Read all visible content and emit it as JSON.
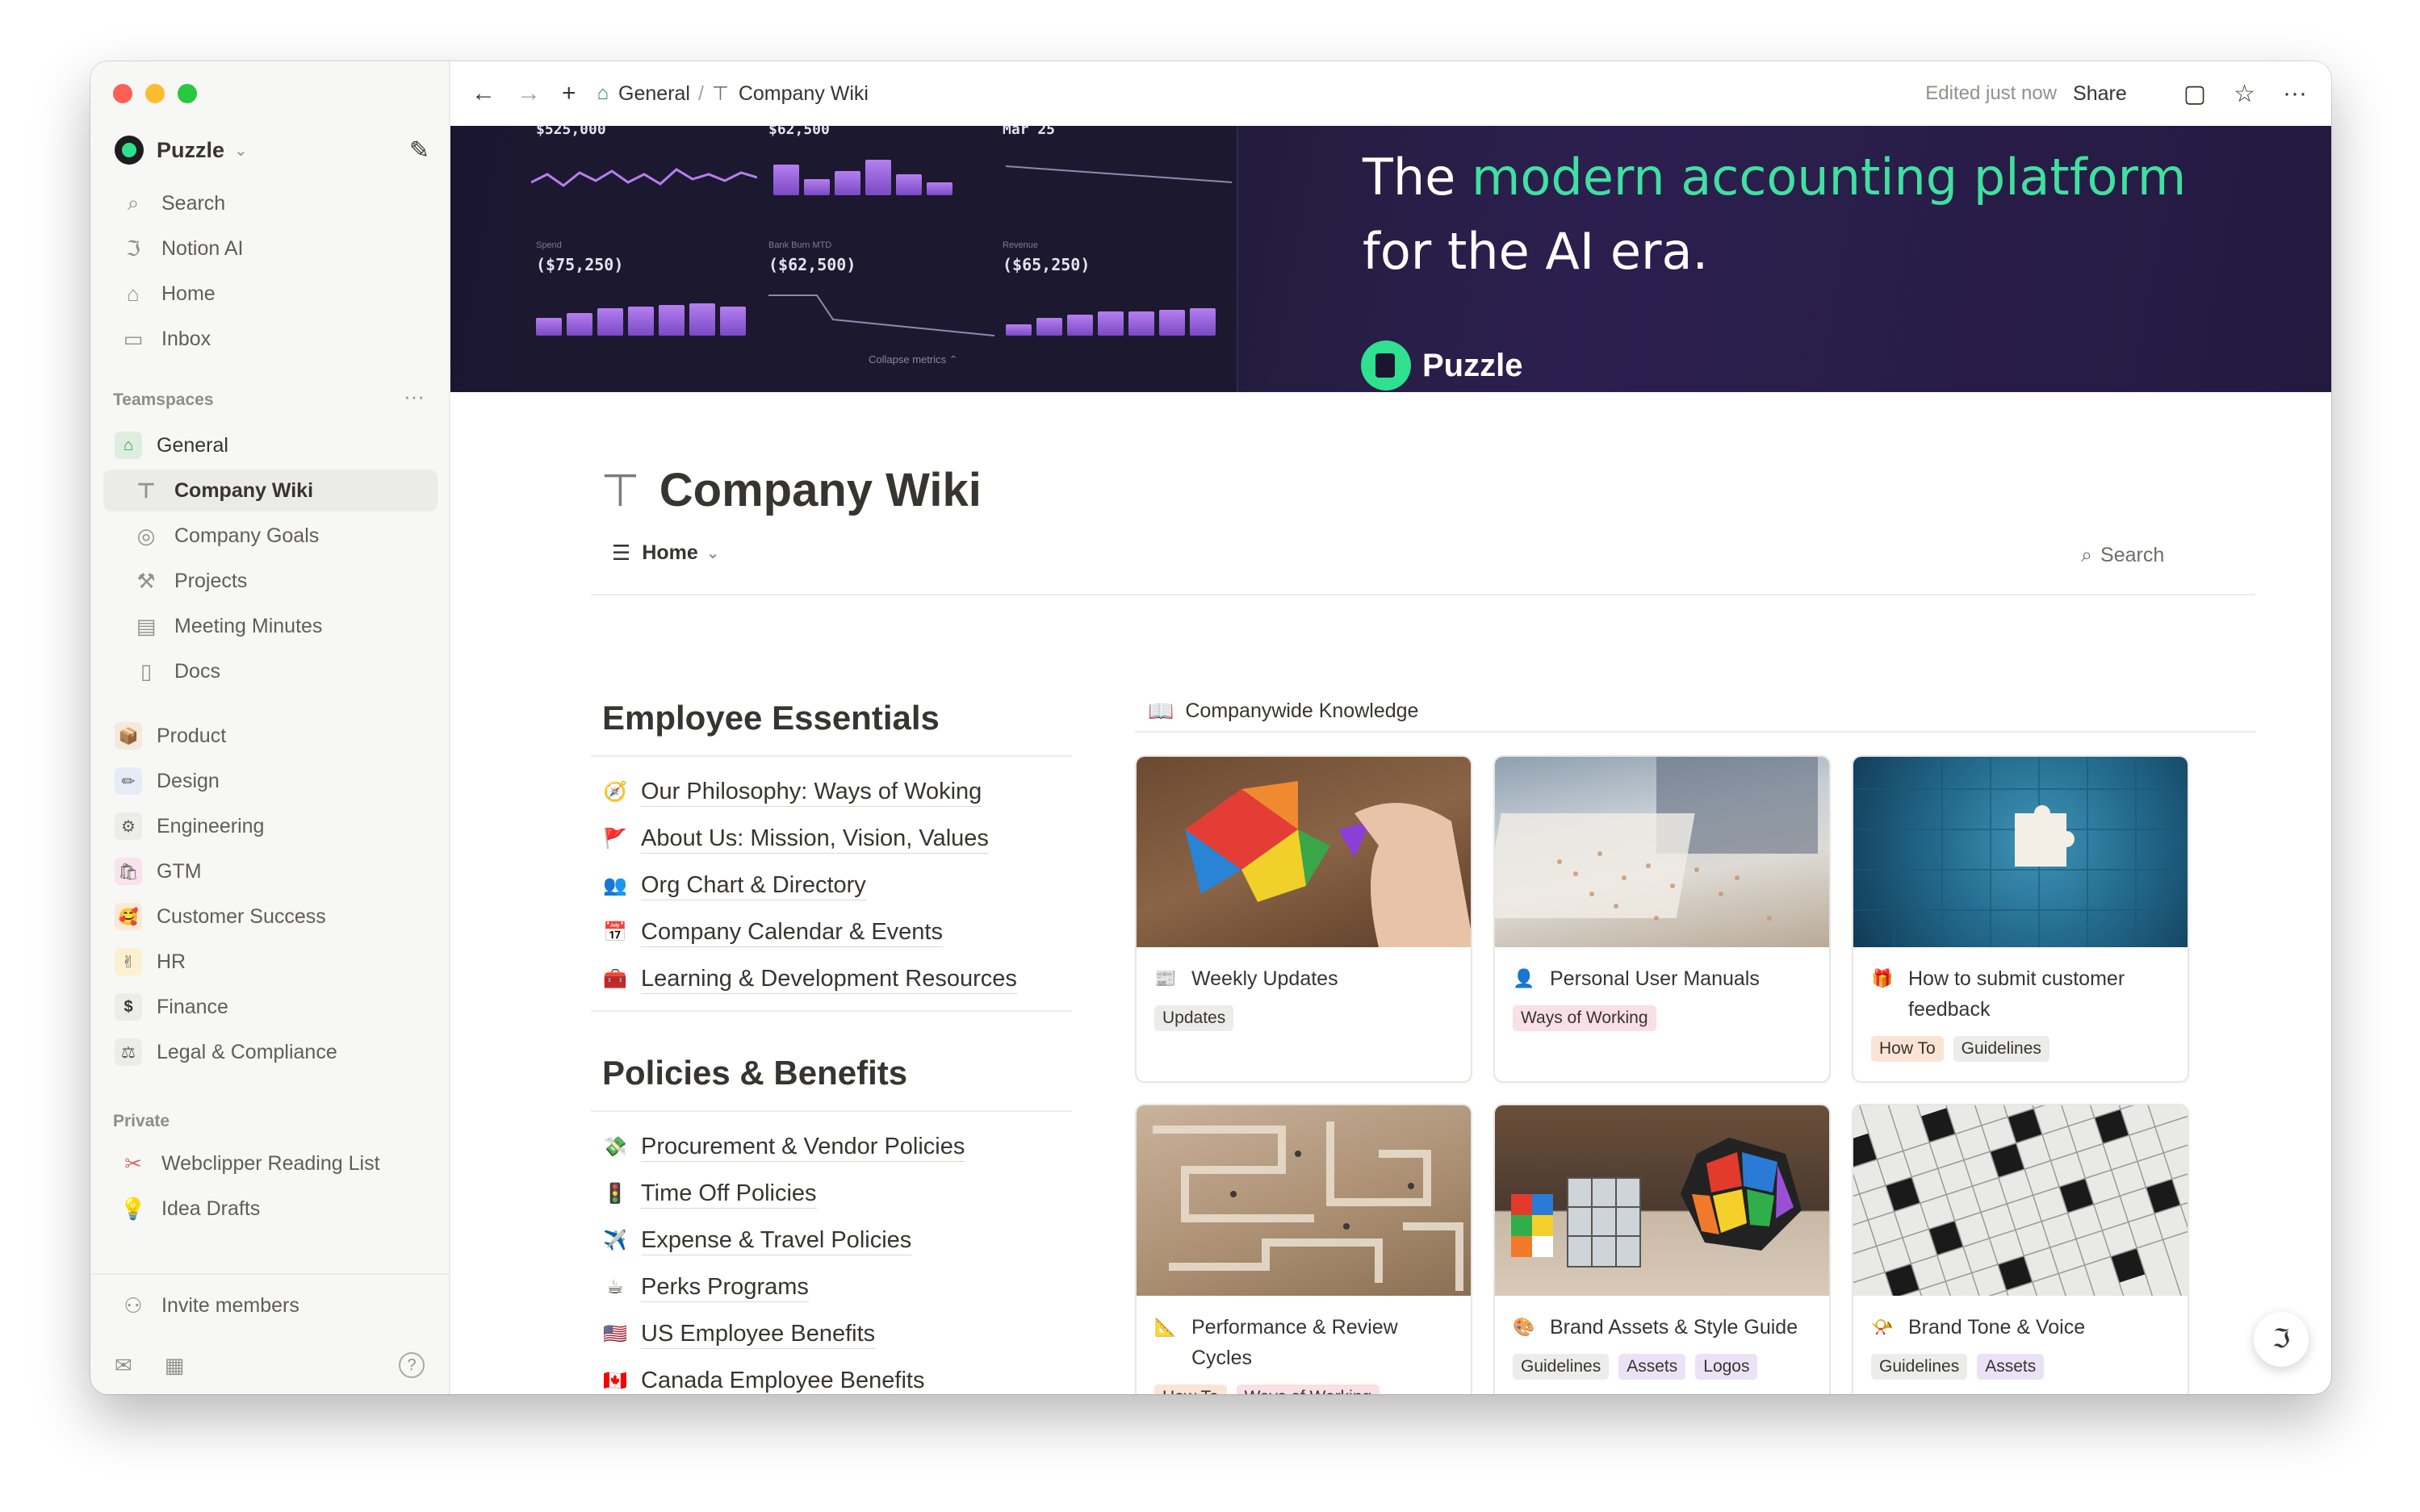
{
  "window": {
    "accent": "#2fe08e"
  },
  "sidebar": {
    "workspace": "Puzzle",
    "top_items": [
      {
        "label": "Search",
        "icon": "search-icon"
      },
      {
        "label": "Notion AI",
        "icon": "notion-ai-icon"
      },
      {
        "label": "Home",
        "icon": "home-icon"
      },
      {
        "label": "Inbox",
        "icon": "inbox-icon"
      }
    ],
    "teamspaces_label": "Teamspaces",
    "general": "General",
    "general_pages": [
      {
        "label": "Company Wiki",
        "icon": "org-chart-icon",
        "active": true
      },
      {
        "label": "Company Goals",
        "icon": "target-icon"
      },
      {
        "label": "Projects",
        "icon": "hammer-icon"
      },
      {
        "label": "Meeting Minutes",
        "icon": "calendar-icon"
      },
      {
        "label": "Docs",
        "icon": "document-icon"
      }
    ],
    "teams": [
      {
        "label": "Product",
        "icon": "package-icon",
        "color": "#f3e9dd"
      },
      {
        "label": "Design",
        "icon": "pencil-icon",
        "color": "#e4ecf7"
      },
      {
        "label": "Engineering",
        "icon": "gear-icon",
        "color": "#ececeb"
      },
      {
        "label": "GTM",
        "icon": "shopping-bags-icon",
        "color": "#f8e3ec"
      },
      {
        "label": "Customer Success",
        "icon": "smile-icon",
        "color": "#fbe9d4"
      },
      {
        "label": "HR",
        "icon": "hand-icon",
        "color": "#fbf0cf"
      },
      {
        "label": "Finance",
        "icon": "dollar-icon",
        "color": "#ececeb"
      },
      {
        "label": "Legal & Compliance",
        "icon": "scales-icon",
        "color": "#ececeb"
      }
    ],
    "private_label": "Private",
    "private_pages": [
      {
        "label": "Webclipper Reading List",
        "icon": "scissors-icon"
      },
      {
        "label": "Idea Drafts",
        "icon": "lightbulb-icon"
      }
    ],
    "invite": "Invite members"
  },
  "topbar": {
    "breadcrumb_parent": "General",
    "breadcrumb_sep": "/",
    "breadcrumb_current": "Company Wiki",
    "edited": "Edited just now",
    "share": "Share"
  },
  "banner": {
    "headline_pre": "The ",
    "headline_accent": "modern accounting platform",
    "headline_post": "for the AI era.",
    "brand": "Puzzle",
    "dashboard": {
      "top_vals": [
        "$525,000",
        "$62,500",
        "Mar 25"
      ],
      "panels": [
        {
          "label": "Spend",
          "value": "($75,250)"
        },
        {
          "label": "Bank Burn MTD",
          "value": "($62,500)"
        },
        {
          "label": "Revenue",
          "value": "($65,250)"
        }
      ],
      "collapse": "Collapse metrics ⌃"
    }
  },
  "page": {
    "title": "Company Wiki",
    "view_tab": "Home",
    "search": "Search"
  },
  "essentials": {
    "heading": "Employee Essentials",
    "links": [
      {
        "icon": "compass-icon",
        "emoji": "🧭",
        "label": "Our Philosophy: Ways of Woking"
      },
      {
        "icon": "flag-icon",
        "emoji": "🚩",
        "label": "About Us: Mission, Vision, Values"
      },
      {
        "icon": "people-icon",
        "emoji": "👥",
        "label": "Org Chart & Directory"
      },
      {
        "icon": "calendar-icon",
        "emoji": "📅",
        "label": "Company Calendar & Events"
      },
      {
        "icon": "toolbox-icon",
        "emoji": "🧰",
        "label": "Learning & Development Resources"
      }
    ]
  },
  "policies": {
    "heading": "Policies & Benefits",
    "links": [
      {
        "icon": "money-icon",
        "emoji": "💸",
        "label": "Procurement & Vendor Policies"
      },
      {
        "icon": "traffic-light-icon",
        "emoji": "🚦",
        "label": "Time Off Policies"
      },
      {
        "icon": "airplane-icon",
        "emoji": "✈️",
        "label": "Expense & Travel Policies"
      },
      {
        "icon": "coffee-icon",
        "emoji": "☕",
        "label": "Perks Programs"
      },
      {
        "icon": "us-flag-icon",
        "emoji": "🇺🇸",
        "label": "US Employee Benefits"
      },
      {
        "icon": "canada-flag-icon",
        "emoji": "🇨🇦",
        "label": "Canada Employee Benefits"
      }
    ]
  },
  "knowledge": {
    "heading": "Companywide Knowledge",
    "cards": [
      {
        "title": "Weekly Updates",
        "icon": "newspaper-icon",
        "emoji": "📰",
        "image": "tangram-photo",
        "tags": [
          {
            "label": "Updates",
            "color": "#ececeb"
          }
        ]
      },
      {
        "title": "Personal User Manuals",
        "icon": "person-icon",
        "emoji": "👤",
        "image": "puzzle-table-photo",
        "tags": [
          {
            "label": "Ways of Working",
            "color": "#fadfe4"
          }
        ]
      },
      {
        "title": "How to submit customer feedback",
        "icon": "gift-icon",
        "emoji": "🎁",
        "image": "blue-puzzle-photo",
        "tags": [
          {
            "label": "How To",
            "color": "#fbe3d6"
          },
          {
            "label": "Guidelines",
            "color": "#ececeb"
          }
        ]
      },
      {
        "title": "Performance & Review Cycles",
        "icon": "triangle-ruler-icon",
        "emoji": "📐",
        "image": "maze-photo",
        "tags": [
          {
            "label": "How To",
            "color": "#fbe3d6"
          },
          {
            "label": "Ways of Working",
            "color": "#fadfe4"
          }
        ]
      },
      {
        "title": "Brand Assets & Style Guide",
        "icon": "palette-icon",
        "emoji": "🎨",
        "image": "cubes-photo",
        "tags": [
          {
            "label": "Guidelines",
            "color": "#ececeb"
          },
          {
            "label": "Assets",
            "color": "#ece2f5"
          },
          {
            "label": "Logos",
            "color": "#ece2f5"
          }
        ]
      },
      {
        "title": "Brand Tone & Voice",
        "icon": "horn-icon",
        "emoji": "📯",
        "image": "crossword-photo",
        "tags": [
          {
            "label": "Guidelines",
            "color": "#ececeb"
          },
          {
            "label": "Assets",
            "color": "#ece2f5"
          }
        ]
      }
    ]
  }
}
